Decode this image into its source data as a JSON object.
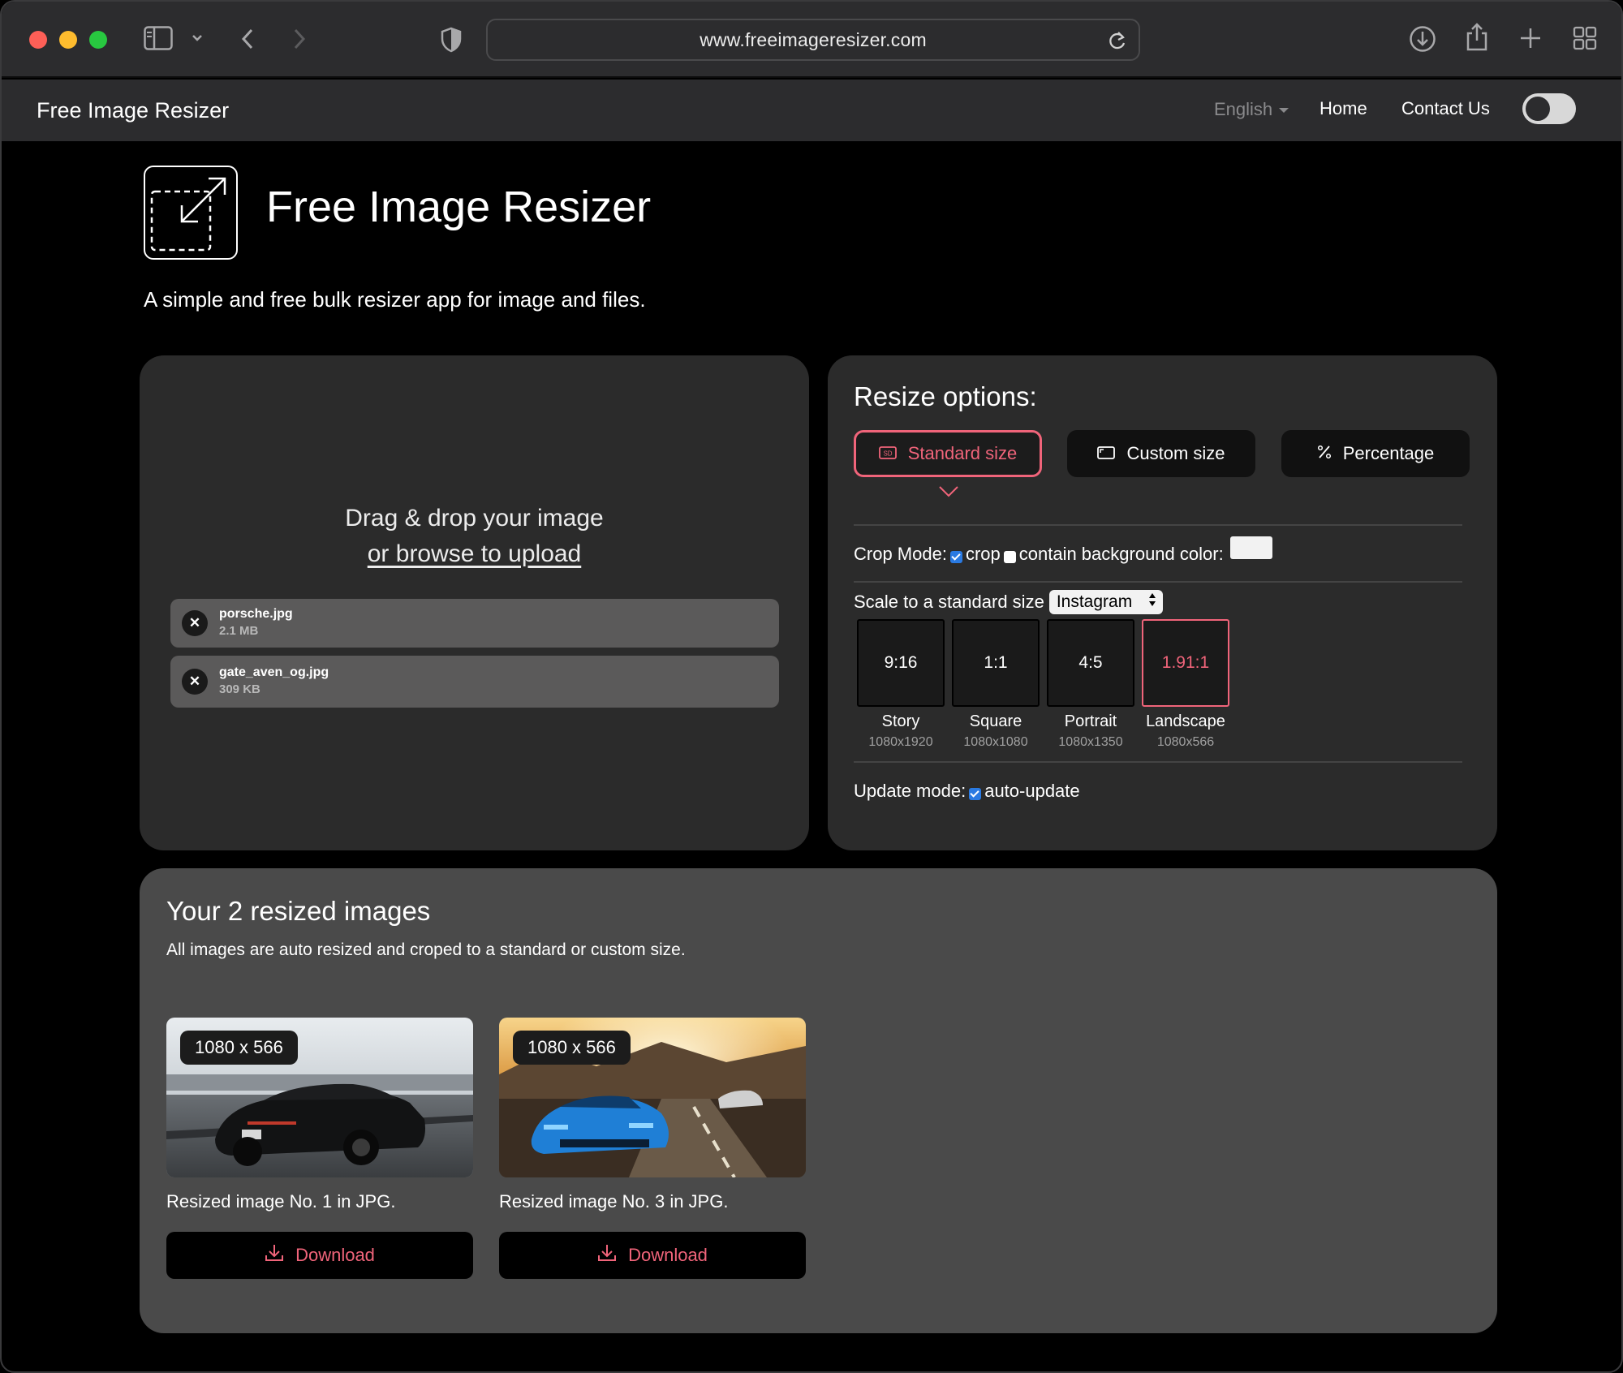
{
  "browser": {
    "url": "www.freeimageresizer.com"
  },
  "nav": {
    "brand": "Free Image Resizer",
    "language": "English",
    "home": "Home",
    "contact": "Contact Us"
  },
  "hero": {
    "title": "Free Image Resizer",
    "subtitle": "A simple and free bulk resizer app for image and files."
  },
  "upload": {
    "drop_text": "Drag & drop your image",
    "browse_text": "or browse to upload",
    "files": [
      {
        "name": "porsche.jpg",
        "size": "2.1 MB"
      },
      {
        "name": "gate_aven_og.jpg",
        "size": "309 KB"
      }
    ]
  },
  "options": {
    "title": "Resize options:",
    "modes": [
      {
        "label": "Standard size",
        "icon": "sd-icon",
        "active": true
      },
      {
        "label": "Custom size",
        "icon": "aspect-icon",
        "active": false
      },
      {
        "label": "Percentage",
        "icon": "percent-icon",
        "active": false
      }
    ],
    "crop_mode_label": "Crop Mode:",
    "crop_label": "crop",
    "contain_label": "contain background color:",
    "background_color": "#f2f2f2",
    "scale_label": "Scale to a standard size",
    "scale_selected": "Instagram",
    "ratios": [
      {
        "ratio": "9:16",
        "name": "Story",
        "dims": "1080x1920",
        "active": false
      },
      {
        "ratio": "1:1",
        "name": "Square",
        "dims": "1080x1080",
        "active": false
      },
      {
        "ratio": "4:5",
        "name": "Portrait",
        "dims": "1080x1350",
        "active": false
      },
      {
        "ratio": "1.91:1",
        "name": "Landscape",
        "dims": "1080x566",
        "active": true
      }
    ],
    "update_mode_label": "Update mode:",
    "auto_update_label": "auto-update"
  },
  "results": {
    "title": "Your 2 resized images",
    "subtitle": "All images are auto resized and croped to a standard or custom size.",
    "images": [
      {
        "badge": "1080 x 566",
        "caption": "Resized image No. 1 in JPG.",
        "download": "Download"
      },
      {
        "badge": "1080 x 566",
        "caption": "Resized image No. 3 in JPG.",
        "download": "Download"
      }
    ]
  },
  "colors": {
    "accent": "#f0647a",
    "checkbox": "#2a7ae2"
  }
}
